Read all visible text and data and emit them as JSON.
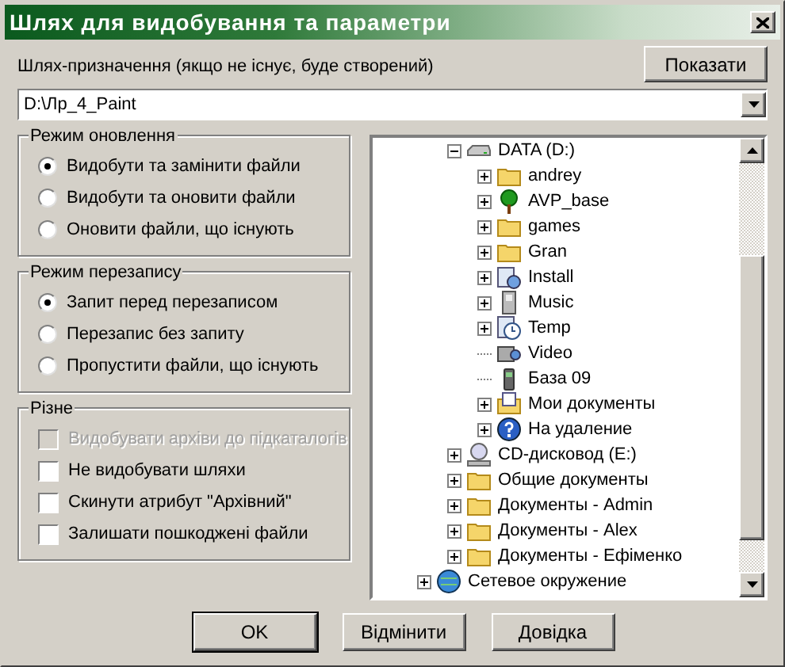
{
  "window": {
    "title": "Шлях для видобування та параметри"
  },
  "destination": {
    "label": "Шлях-призначення (якщо не існує, буде створений)",
    "value": "D:\\Лр_4_Paint",
    "show_button": "Показати"
  },
  "groups": [
    {
      "title": "Режим оновлення",
      "kind": "radio",
      "options": [
        {
          "label": "Видобути та замінити файли",
          "selected": true
        },
        {
          "label": "Видобути та оновити файли",
          "selected": false
        },
        {
          "label": "Оновити файли, що існують",
          "selected": false
        }
      ]
    },
    {
      "title": "Режим перезапису",
      "kind": "radio",
      "options": [
        {
          "label": "Запит перед перезаписом",
          "selected": true
        },
        {
          "label": "Перезапис без запиту",
          "selected": false
        },
        {
          "label": "Пропустити файли, що існують",
          "selected": false
        }
      ]
    },
    {
      "title": "Різне",
      "kind": "checkbox",
      "options": [
        {
          "label": "Видобувати архіви до підкаталогів",
          "checked": false,
          "disabled": true
        },
        {
          "label": "Не видобувати шляхи",
          "checked": false,
          "disabled": false
        },
        {
          "label": "Скинути атрибут \"Архівний\"",
          "checked": false,
          "disabled": false
        },
        {
          "label": "Залишати пошкоджені файли",
          "checked": false,
          "disabled": false
        }
      ]
    }
  ],
  "tree": {
    "branch_items": [
      {
        "label": "DATA (D:)",
        "kind": "drive",
        "expandable": true,
        "expanded": true,
        "children": [
          {
            "label": "andrey",
            "kind": "folder",
            "expandable": true,
            "expanded": false
          },
          {
            "label": "AVP_base",
            "kind": "tree",
            "expandable": true,
            "expanded": false
          },
          {
            "label": "games",
            "kind": "folder",
            "expandable": true,
            "expanded": false
          },
          {
            "label": "Gran",
            "kind": "folder",
            "expandable": true,
            "expanded": false
          },
          {
            "label": "Install",
            "kind": "install",
            "expandable": true,
            "expanded": false
          },
          {
            "label": "Music",
            "kind": "music",
            "expandable": true,
            "expanded": false
          },
          {
            "label": "Temp",
            "kind": "temp",
            "expandable": true,
            "expanded": false
          },
          {
            "label": "Video",
            "kind": "video",
            "expandable": false,
            "expanded": false
          },
          {
            "label": "База 09",
            "kind": "phone",
            "expandable": false,
            "expanded": false
          },
          {
            "label": "Мои документы",
            "kind": "documents",
            "expandable": true,
            "expanded": false
          },
          {
            "label": "На удаление",
            "kind": "help",
            "expandable": true,
            "expanded": false
          }
        ]
      },
      {
        "label": "CD-дисковод (E:)",
        "kind": "cdrom",
        "expandable": true,
        "expanded": false
      },
      {
        "label": "Общие документы",
        "kind": "folder",
        "expandable": true,
        "expanded": false
      },
      {
        "label": "Документы - Admin",
        "kind": "folder",
        "expandable": true,
        "expanded": false
      },
      {
        "label": "Документы - Alex",
        "kind": "folder",
        "expandable": true,
        "expanded": false
      },
      {
        "label": "Документы - Ефіменко",
        "kind": "folder",
        "expandable": true,
        "expanded": false
      }
    ],
    "root_items": [
      {
        "label": "Сетевое окружение",
        "kind": "network",
        "expandable": true,
        "expanded": false
      }
    ]
  },
  "buttons": [
    {
      "label": "OK",
      "kind": "default"
    },
    {
      "label": "Відмінити",
      "kind": "normal"
    },
    {
      "label": "Довідка",
      "kind": "normal"
    }
  ]
}
